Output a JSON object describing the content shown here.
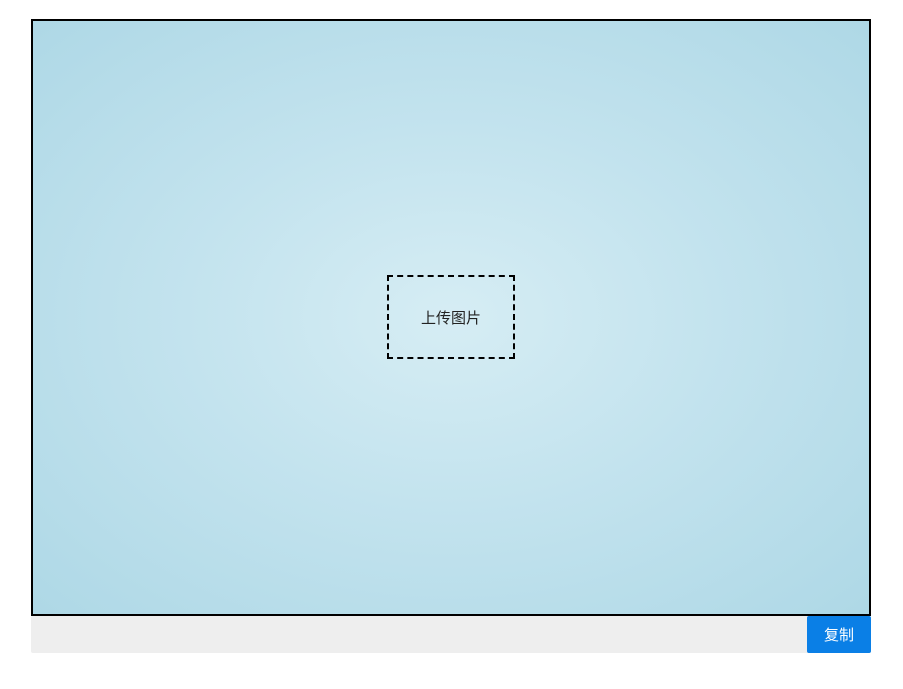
{
  "canvas": {
    "upload_label": "上传图片"
  },
  "output": {
    "value": "",
    "placeholder": ""
  },
  "toolbar": {
    "copy_label": "复制"
  },
  "colors": {
    "canvas_center": "#d6edf4",
    "canvas_edge": "#aed8e6",
    "copy_button": "#0a7fe6",
    "bar_background": "#eeeeee"
  }
}
